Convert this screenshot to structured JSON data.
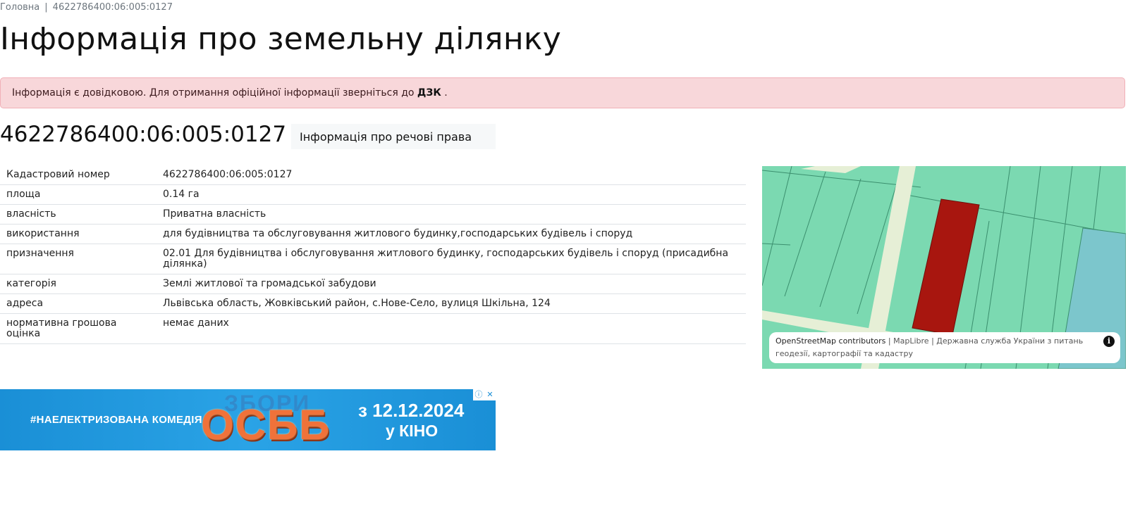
{
  "breadcrumb": {
    "home": "Головна",
    "separator": "|",
    "current": "4622786400:06:005:0127"
  },
  "title": "Інформація про земельну ділянку",
  "alert": {
    "text": "Інформація є довідковою. Для отримання офіційної інформації зверніться до",
    "link": "ДЗК",
    "suffix": "."
  },
  "parcel": {
    "cadastral_number": "4622786400:06:005:0127",
    "rights_button": "Інформація про речові права"
  },
  "info_rows": [
    {
      "label": "Кадастровий номер",
      "value": "4622786400:06:005:0127"
    },
    {
      "label": "площа",
      "value": "0.14 га"
    },
    {
      "label": "власність",
      "value": "Приватна власність"
    },
    {
      "label": "використання",
      "value": "для будівництва та обслуговування житлового будинку,господарських будівель і споруд"
    },
    {
      "label": "призначення",
      "value": "02.01 Для будівництва і обслуговування житлового будинку, господарських будівель і споруд (присадибна ділянка)"
    },
    {
      "label": "категорія",
      "value": "Землі житлової та громадської забудови"
    },
    {
      "label": "адреса",
      "value": "Львівська область, Жовківський район, с.Нове-Село, вулиця Шкільна, 124"
    },
    {
      "label": "нормативна грошова оцінка",
      "value": "немає даних"
    }
  ],
  "map": {
    "attribution": {
      "osm": "OpenStreetMap contributors",
      "sep1": "|",
      "maplibre": "MapLibre",
      "sep2": "|",
      "agency": "Державна служба України з питань геодезії, картографії та кадастру",
      "info_icon": "i"
    },
    "colors": {
      "parcels": "#7bd9b1",
      "parcel_borders": "#3b8f6e",
      "road": "#e6efd6",
      "selected_parcel": "#a8160f",
      "other_parcel": "#7cc6cc"
    }
  },
  "ad": {
    "hashtag": "#НАЕЛЕКТРИЗОВАНА КОМЕДІЯ",
    "title_small": "ЗБОРИ",
    "title_big": "ОСББ",
    "date": "з 12.12.2024",
    "cinema": "у КІНО",
    "info_icon": "ⓘ",
    "close_icon": "✕"
  }
}
